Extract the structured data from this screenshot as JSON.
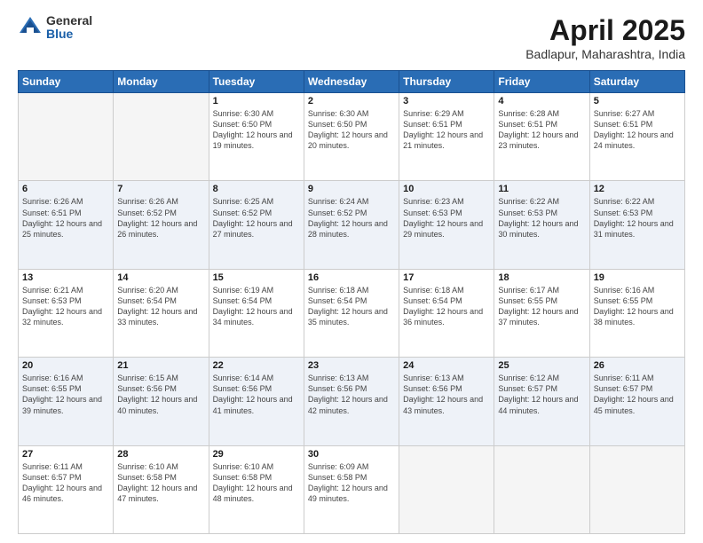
{
  "header": {
    "logo_general": "General",
    "logo_blue": "Blue",
    "title": "April 2025",
    "subtitle": "Badlapur, Maharashtra, India"
  },
  "days_of_week": [
    "Sunday",
    "Monday",
    "Tuesday",
    "Wednesday",
    "Thursday",
    "Friday",
    "Saturday"
  ],
  "weeks": [
    [
      {
        "day": "",
        "info": ""
      },
      {
        "day": "",
        "info": ""
      },
      {
        "day": "1",
        "info": "Sunrise: 6:30 AM\nSunset: 6:50 PM\nDaylight: 12 hours and 19 minutes."
      },
      {
        "day": "2",
        "info": "Sunrise: 6:30 AM\nSunset: 6:50 PM\nDaylight: 12 hours and 20 minutes."
      },
      {
        "day": "3",
        "info": "Sunrise: 6:29 AM\nSunset: 6:51 PM\nDaylight: 12 hours and 21 minutes."
      },
      {
        "day": "4",
        "info": "Sunrise: 6:28 AM\nSunset: 6:51 PM\nDaylight: 12 hours and 23 minutes."
      },
      {
        "day": "5",
        "info": "Sunrise: 6:27 AM\nSunset: 6:51 PM\nDaylight: 12 hours and 24 minutes."
      }
    ],
    [
      {
        "day": "6",
        "info": "Sunrise: 6:26 AM\nSunset: 6:51 PM\nDaylight: 12 hours and 25 minutes."
      },
      {
        "day": "7",
        "info": "Sunrise: 6:26 AM\nSunset: 6:52 PM\nDaylight: 12 hours and 26 minutes."
      },
      {
        "day": "8",
        "info": "Sunrise: 6:25 AM\nSunset: 6:52 PM\nDaylight: 12 hours and 27 minutes."
      },
      {
        "day": "9",
        "info": "Sunrise: 6:24 AM\nSunset: 6:52 PM\nDaylight: 12 hours and 28 minutes."
      },
      {
        "day": "10",
        "info": "Sunrise: 6:23 AM\nSunset: 6:53 PM\nDaylight: 12 hours and 29 minutes."
      },
      {
        "day": "11",
        "info": "Sunrise: 6:22 AM\nSunset: 6:53 PM\nDaylight: 12 hours and 30 minutes."
      },
      {
        "day": "12",
        "info": "Sunrise: 6:22 AM\nSunset: 6:53 PM\nDaylight: 12 hours and 31 minutes."
      }
    ],
    [
      {
        "day": "13",
        "info": "Sunrise: 6:21 AM\nSunset: 6:53 PM\nDaylight: 12 hours and 32 minutes."
      },
      {
        "day": "14",
        "info": "Sunrise: 6:20 AM\nSunset: 6:54 PM\nDaylight: 12 hours and 33 minutes."
      },
      {
        "day": "15",
        "info": "Sunrise: 6:19 AM\nSunset: 6:54 PM\nDaylight: 12 hours and 34 minutes."
      },
      {
        "day": "16",
        "info": "Sunrise: 6:18 AM\nSunset: 6:54 PM\nDaylight: 12 hours and 35 minutes."
      },
      {
        "day": "17",
        "info": "Sunrise: 6:18 AM\nSunset: 6:54 PM\nDaylight: 12 hours and 36 minutes."
      },
      {
        "day": "18",
        "info": "Sunrise: 6:17 AM\nSunset: 6:55 PM\nDaylight: 12 hours and 37 minutes."
      },
      {
        "day": "19",
        "info": "Sunrise: 6:16 AM\nSunset: 6:55 PM\nDaylight: 12 hours and 38 minutes."
      }
    ],
    [
      {
        "day": "20",
        "info": "Sunrise: 6:16 AM\nSunset: 6:55 PM\nDaylight: 12 hours and 39 minutes."
      },
      {
        "day": "21",
        "info": "Sunrise: 6:15 AM\nSunset: 6:56 PM\nDaylight: 12 hours and 40 minutes."
      },
      {
        "day": "22",
        "info": "Sunrise: 6:14 AM\nSunset: 6:56 PM\nDaylight: 12 hours and 41 minutes."
      },
      {
        "day": "23",
        "info": "Sunrise: 6:13 AM\nSunset: 6:56 PM\nDaylight: 12 hours and 42 minutes."
      },
      {
        "day": "24",
        "info": "Sunrise: 6:13 AM\nSunset: 6:56 PM\nDaylight: 12 hours and 43 minutes."
      },
      {
        "day": "25",
        "info": "Sunrise: 6:12 AM\nSunset: 6:57 PM\nDaylight: 12 hours and 44 minutes."
      },
      {
        "day": "26",
        "info": "Sunrise: 6:11 AM\nSunset: 6:57 PM\nDaylight: 12 hours and 45 minutes."
      }
    ],
    [
      {
        "day": "27",
        "info": "Sunrise: 6:11 AM\nSunset: 6:57 PM\nDaylight: 12 hours and 46 minutes."
      },
      {
        "day": "28",
        "info": "Sunrise: 6:10 AM\nSunset: 6:58 PM\nDaylight: 12 hours and 47 minutes."
      },
      {
        "day": "29",
        "info": "Sunrise: 6:10 AM\nSunset: 6:58 PM\nDaylight: 12 hours and 48 minutes."
      },
      {
        "day": "30",
        "info": "Sunrise: 6:09 AM\nSunset: 6:58 PM\nDaylight: 12 hours and 49 minutes."
      },
      {
        "day": "",
        "info": ""
      },
      {
        "day": "",
        "info": ""
      },
      {
        "day": "",
        "info": ""
      }
    ]
  ]
}
